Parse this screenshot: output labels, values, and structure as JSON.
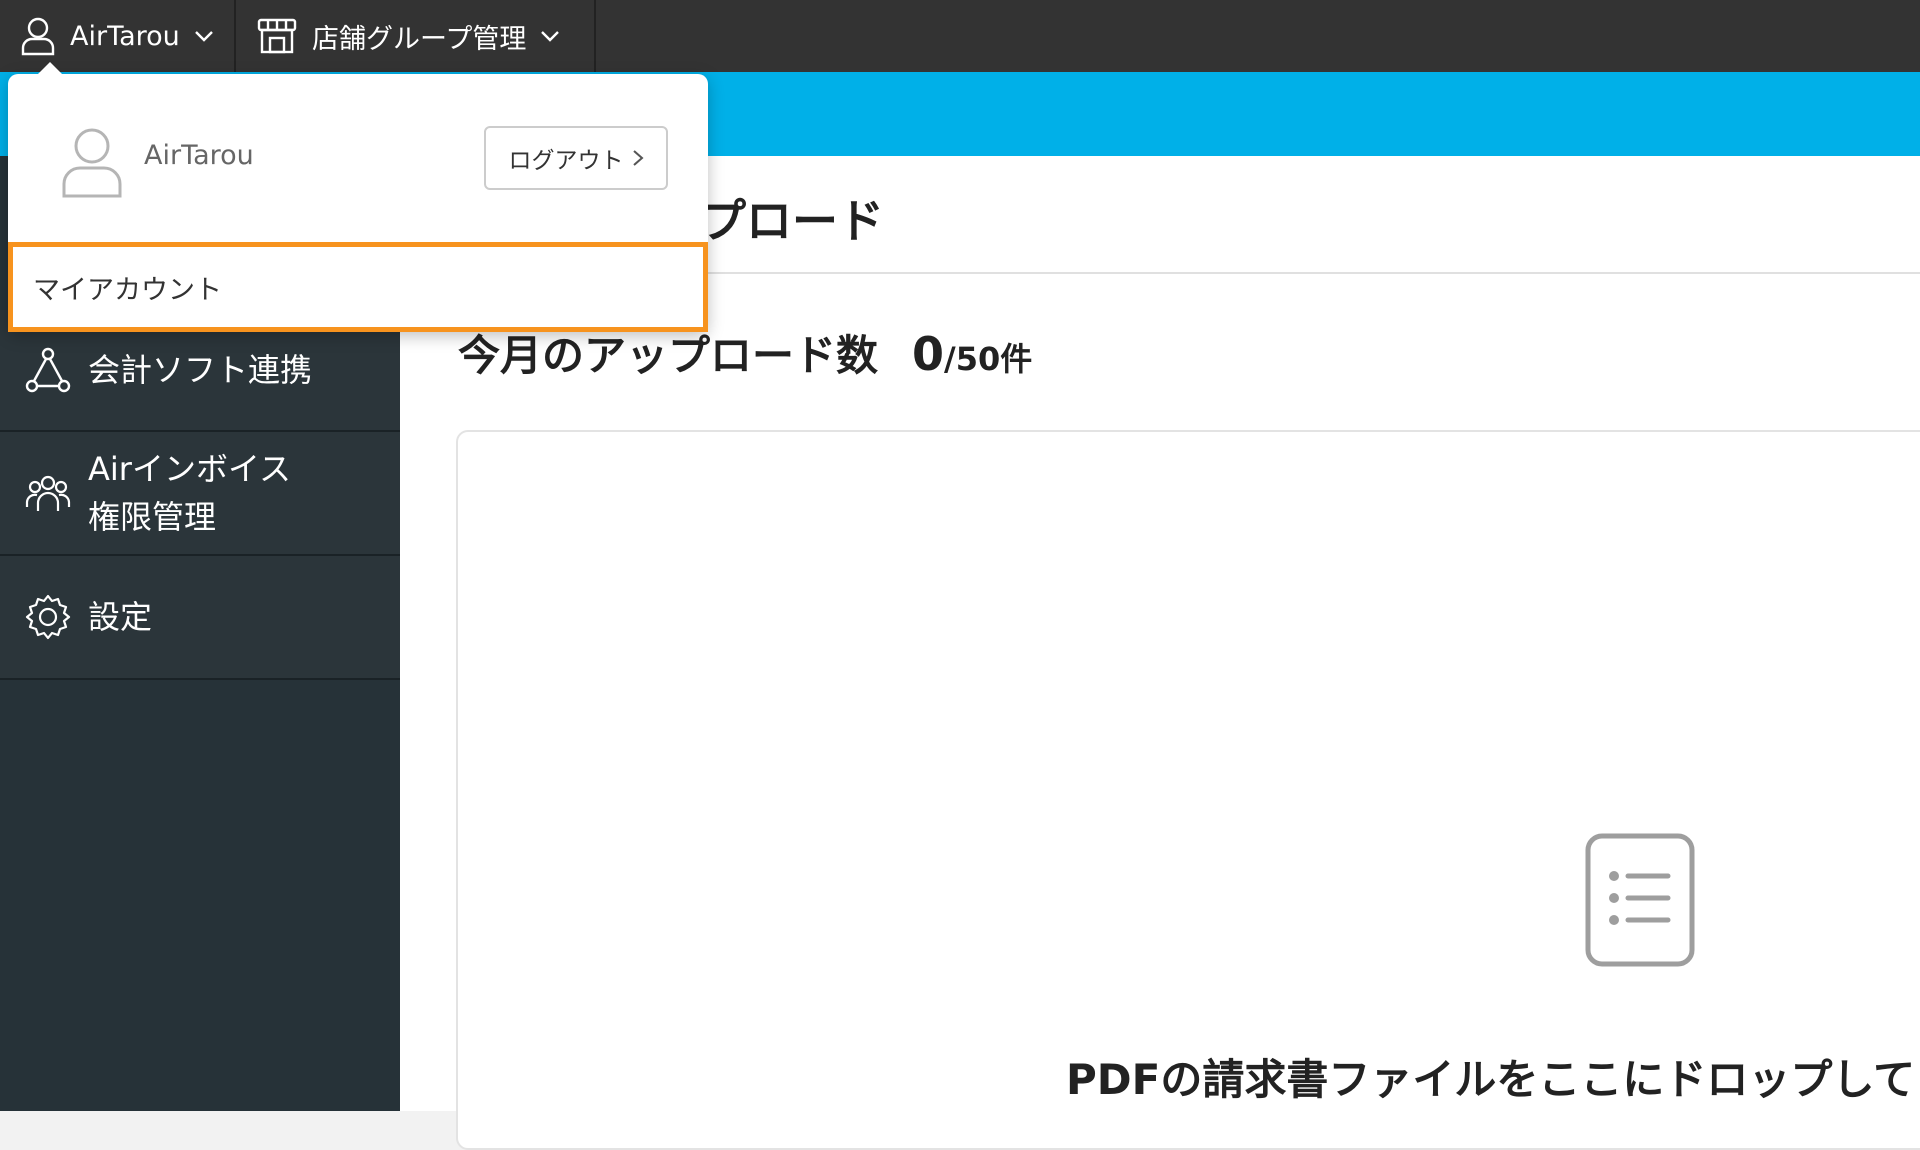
{
  "topbar": {
    "user_label": "AirTarou",
    "store_group_label": "店舗グループ管理"
  },
  "dropdown": {
    "user_name": "AirTarou",
    "logout_label": "ログアウト",
    "my_account_label": "マイアカウント"
  },
  "sidebar": {
    "items": [
      {
        "label": "会計ソフト連携",
        "icon": "network-icon"
      },
      {
        "label_line1": "Airインボイス",
        "label_line2": "権限管理",
        "icon": "users-icon"
      },
      {
        "label": "設定",
        "icon": "gear-icon"
      }
    ]
  },
  "main": {
    "page_title": "プロード",
    "upload_count_label": "今月のアップロード数",
    "upload_count_value": "0",
    "upload_count_limit": "/50件",
    "drop_text": "PDFの請求書ファイルをここにドロップして"
  },
  "colors": {
    "topbar": "#333333",
    "accent_blue": "#00b0e8",
    "sidebar": "#263238",
    "highlight": "#f7931e"
  }
}
